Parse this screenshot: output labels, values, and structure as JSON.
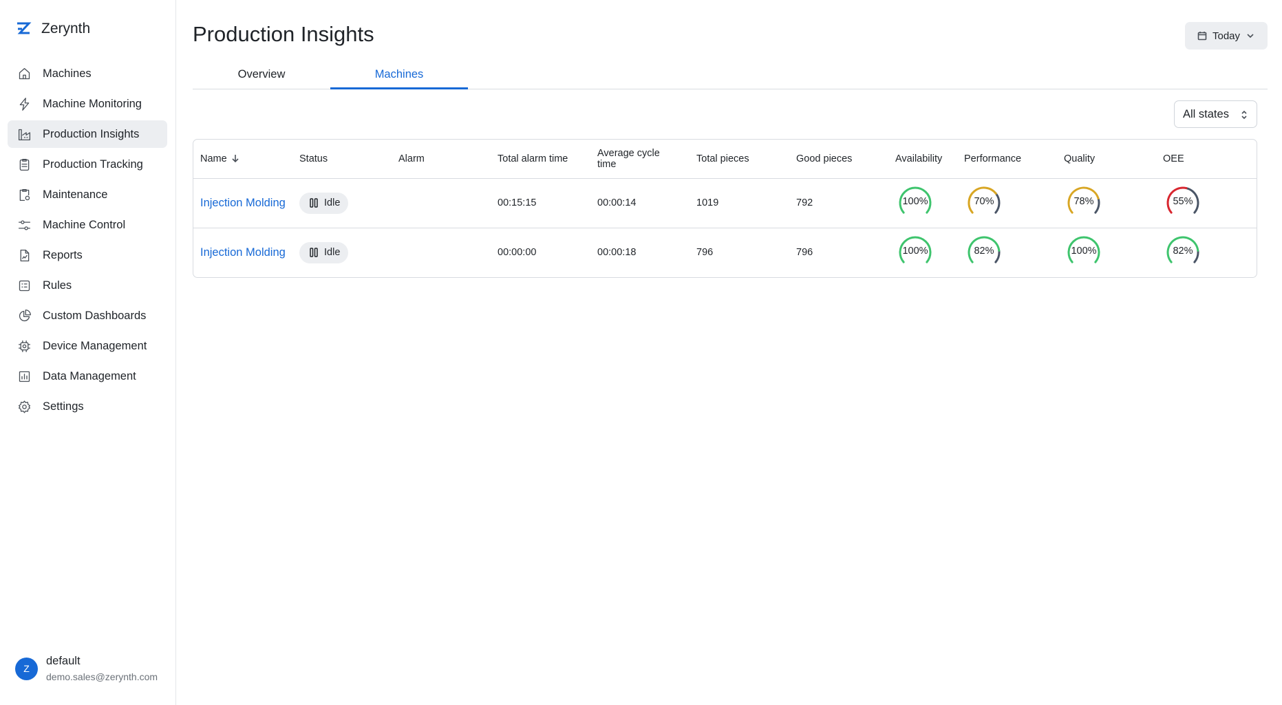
{
  "app": {
    "brand_name": "Zerynth",
    "accent_color": "#1769d6"
  },
  "sidebar": {
    "items": [
      {
        "label": "Machines",
        "icon": "home-icon"
      },
      {
        "label": "Machine Monitoring",
        "icon": "lightning-icon"
      },
      {
        "label": "Production Insights",
        "icon": "factory-icon",
        "active": true
      },
      {
        "label": "Production Tracking",
        "icon": "clipboard-icon"
      },
      {
        "label": "Maintenance",
        "icon": "clipboard-gear-icon"
      },
      {
        "label": "Machine Control",
        "icon": "sliders-icon"
      },
      {
        "label": "Reports",
        "icon": "document-chart-icon"
      },
      {
        "label": "Rules",
        "icon": "checklist-icon"
      },
      {
        "label": "Custom Dashboards",
        "icon": "pie-chart-icon"
      },
      {
        "label": "Device Management",
        "icon": "chip-gear-icon"
      },
      {
        "label": "Data Management",
        "icon": "bar-chart-icon"
      },
      {
        "label": "Settings",
        "icon": "gear-icon"
      }
    ]
  },
  "user": {
    "avatar_initial": "Z",
    "name": "default",
    "email": "demo.sales@zerynth.com"
  },
  "header": {
    "title": "Production Insights",
    "date_filter": "Today"
  },
  "tabs": [
    {
      "label": "Overview",
      "active": false
    },
    {
      "label": "Machines",
      "active": true
    }
  ],
  "filters": {
    "state_select": "All states"
  },
  "table": {
    "columns": {
      "name": "Name",
      "status": "Status",
      "alarm": "Alarm",
      "total_alarm_time": "Total alarm time",
      "average_cycle_time": "Average cycle time",
      "total_pieces": "Total pieces",
      "good_pieces": "Good pieces",
      "availability": "Availability",
      "performance": "Performance",
      "quality": "Quality",
      "oee": "OEE"
    },
    "rows": [
      {
        "name": "Injection Molding",
        "status": "Idle",
        "alarm": "",
        "total_alarm_time": "00:15:15",
        "average_cycle_time": "00:00:14",
        "total_pieces": "1019",
        "good_pieces": "792",
        "availability": {
          "label": "100%",
          "value": 100,
          "color": "#3ec46d"
        },
        "performance": {
          "label": "70%",
          "value": 70,
          "color": "#d8a624"
        },
        "quality": {
          "label": "78%",
          "value": 78,
          "color": "#d8a624"
        },
        "oee": {
          "label": "55%",
          "value": 55,
          "color": "#d8262f"
        }
      },
      {
        "name": "Injection Molding",
        "status": "Idle",
        "alarm": "",
        "total_alarm_time": "00:00:00",
        "average_cycle_time": "00:00:18",
        "total_pieces": "796",
        "good_pieces": "796",
        "availability": {
          "label": "100%",
          "value": 100,
          "color": "#3ec46d"
        },
        "performance": {
          "label": "82%",
          "value": 82,
          "color": "#3ec46d"
        },
        "quality": {
          "label": "100%",
          "value": 100,
          "color": "#3ec46d"
        },
        "oee": {
          "label": "82%",
          "value": 82,
          "color": "#3ec46d"
        }
      }
    ]
  },
  "gauge_track_color": "#4a5566"
}
